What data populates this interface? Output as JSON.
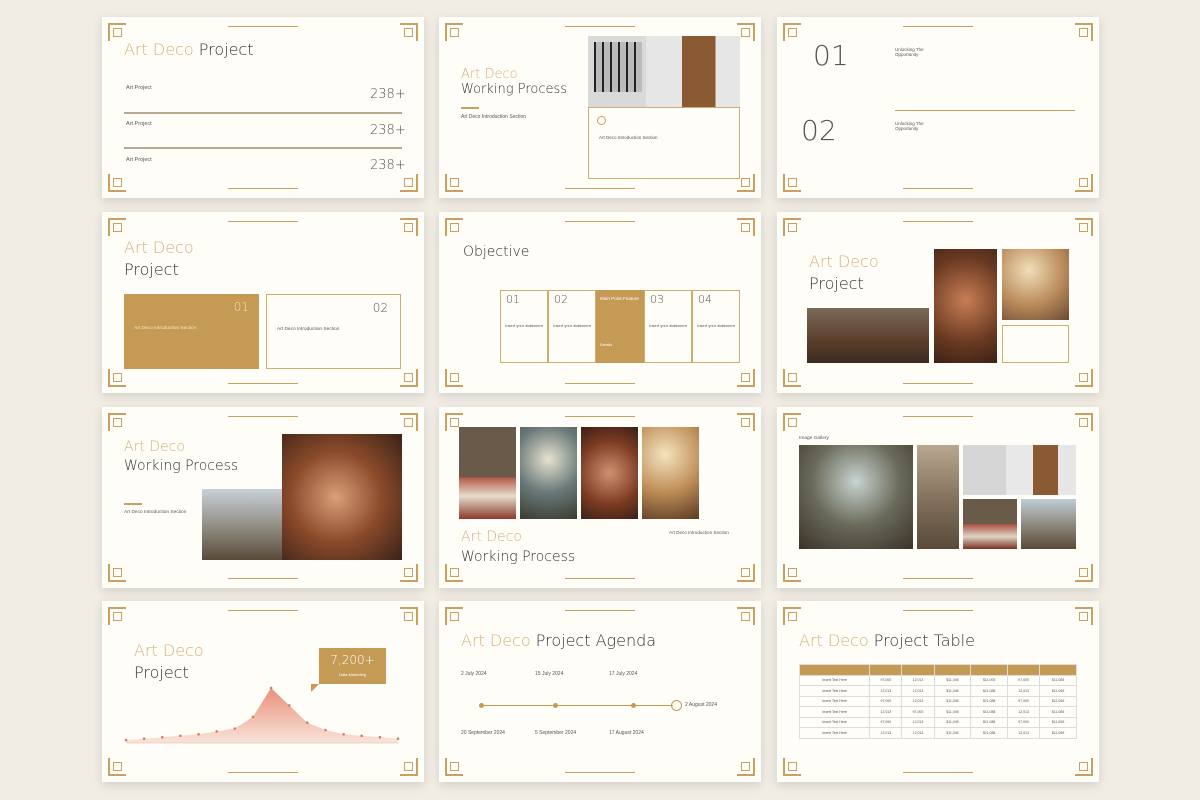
{
  "slide1": {
    "title_gold": "Art Deco",
    "title_dark": "Project",
    "rows": [
      {
        "label": "Art Project",
        "value": "238+"
      },
      {
        "label": "Art Project",
        "value": "238+"
      },
      {
        "label": "Art Project",
        "value": "238+"
      }
    ]
  },
  "slide2": {
    "title_gold": "Art Deco",
    "title_dark": "Working Process",
    "caption": "Art Deco Introduction Section",
    "box_caption": "Art Deco Introduction Section"
  },
  "slide3": {
    "items": [
      {
        "num": "01",
        "heading": "Unlocking The Opportunity"
      },
      {
        "num": "02",
        "heading": "Unlocking The Opportunity"
      }
    ]
  },
  "slide4": {
    "title_gold": "Art Deco",
    "title_dark": "Project",
    "box1_num": "01",
    "box1_caption": "Art Deco Introduction Section",
    "box2_num": "02",
    "box2_caption": "Art Deco Introduction Section"
  },
  "slide5": {
    "title": "Objective",
    "cols": [
      {
        "num": "01",
        "text": "Insert your statement"
      },
      {
        "num": "02",
        "text": "Insert your statement"
      },
      {
        "num": "Main Point Feature",
        "text": "Details"
      },
      {
        "num": "03",
        "text": "Insert your statement"
      },
      {
        "num": "04",
        "text": "Insert your statement"
      }
    ]
  },
  "slide6": {
    "title_gold": "Art Deco",
    "title_dark": "Project"
  },
  "slide7": {
    "title_gold": "Art Deco",
    "title_dark": "Working Process",
    "caption": "Art Deco Introduction Section"
  },
  "slide8": {
    "title_gold": "Art Deco",
    "title_dark": "Working Process",
    "caption": "Art Deco Introduction Section"
  },
  "slide9": {
    "label": "Image Gallery"
  },
  "slide10": {
    "title_gold": "Art Deco",
    "title_dark": "Project",
    "callout_value": "7,200+",
    "callout_label": "Data Marketing",
    "chart_data": {
      "type": "area",
      "values": [
        2,
        3,
        4,
        5,
        6,
        8,
        10,
        18,
        38,
        26,
        14,
        9,
        6,
        5,
        4,
        3
      ]
    }
  },
  "slide11": {
    "title_gold": "Art Deco",
    "title_dark": "Project Agenda",
    "dates_top": [
      "2 July 2024",
      "15 July 2024",
      "17 July 2024"
    ],
    "date_right": "2 August 2024",
    "dates_bottom": [
      "20 September 2024",
      "5 September 2024",
      "17 August 2024"
    ]
  },
  "slide12": {
    "title_gold": "Art Deco",
    "title_dark": "Project Table",
    "rows": [
      [
        "Insert Text Here",
        "97,000",
        "12,013",
        "$11,045",
        "$11,000",
        "97,000",
        "$11,065"
      ],
      [
        "Insert Text Here",
        "12,013",
        "12,013",
        "$11,045",
        "$11,088",
        "12,013",
        "$11,065"
      ],
      [
        "Insert Text Here",
        "97,000",
        "12,013",
        "$11,045",
        "$11,088",
        "97,000",
        "$11,065"
      ],
      [
        "Insert Text Here",
        "12,013",
        "97,000",
        "$11,045",
        "$11,088",
        "12,013",
        "$11,065"
      ],
      [
        "Insert Text Here",
        "97,000",
        "12,013",
        "$11,045",
        "$11,088",
        "97,000",
        "$11,065"
      ],
      [
        "Insert Text Here",
        "12,013",
        "12,013",
        "$11,045",
        "$11,088",
        "12,013",
        "$11,065"
      ]
    ]
  }
}
